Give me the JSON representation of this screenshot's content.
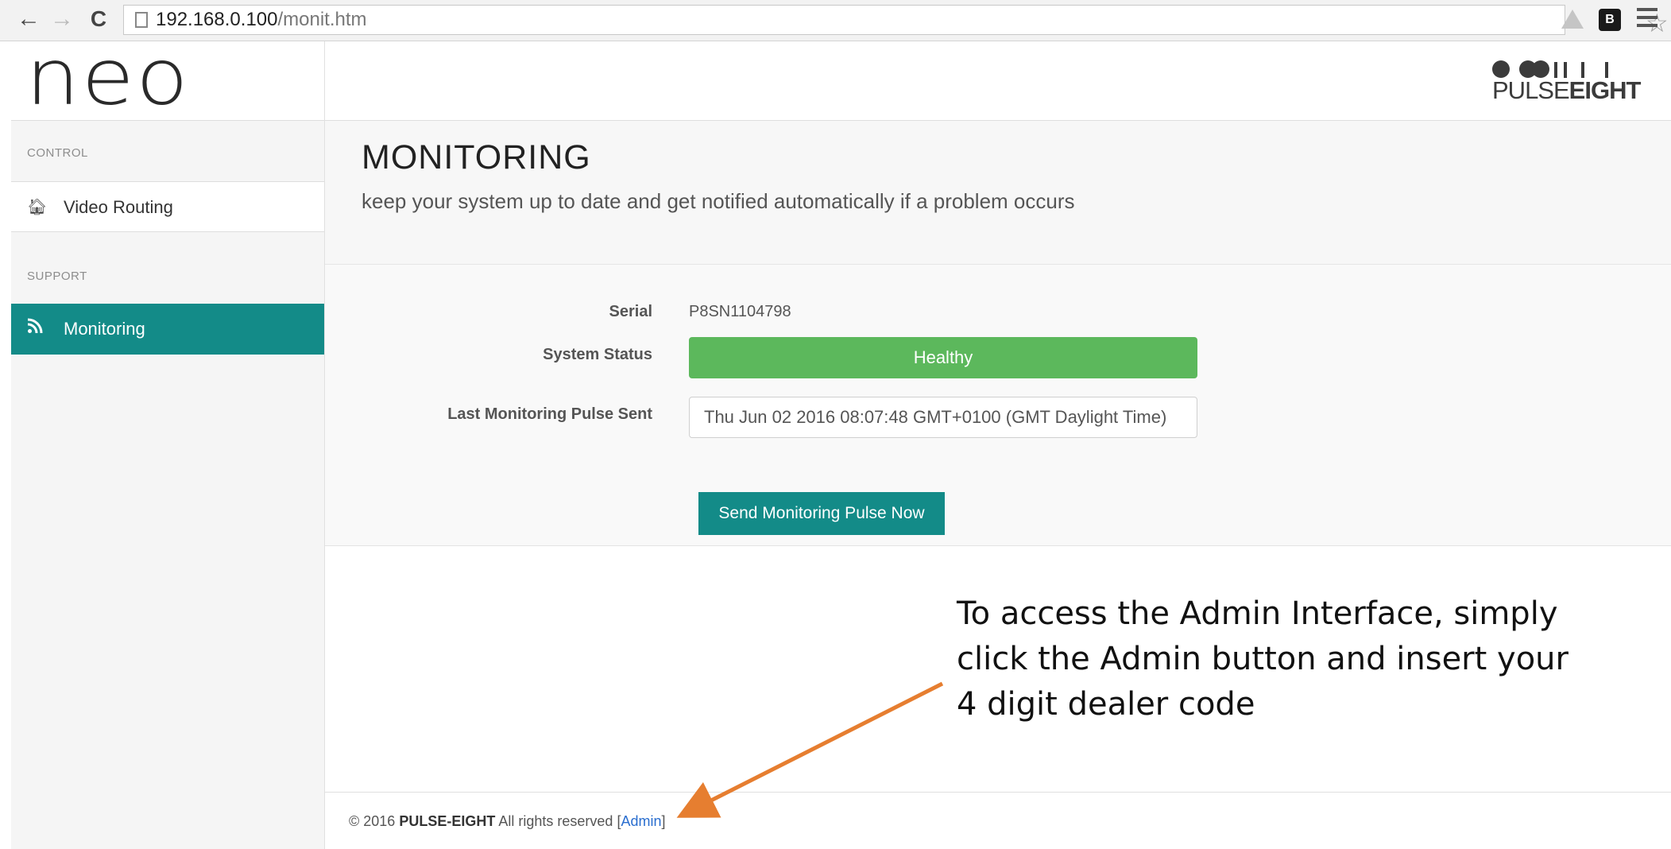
{
  "browser": {
    "url_host": "192.168.0.100",
    "url_path": "/monit.htm",
    "extension_badge": "B"
  },
  "header": {
    "brand": "neo",
    "logo_left": "PULSE",
    "logo_right": "EIGHT"
  },
  "sidebar": {
    "section_control": "CONTROL",
    "video_routing": "Video Routing",
    "section_support": "SUPPORT",
    "monitoring": "Monitoring",
    "active_item": "Monitoring",
    "accent_color": "#138b88"
  },
  "main": {
    "title": "MONITORING",
    "subtitle": "keep your system up to date and get notified automatically if a problem occurs",
    "serial_label": "Serial",
    "serial_value": "P8SN1104798",
    "status_label": "System Status",
    "status_value": "Healthy",
    "status_color": "#5cb85c",
    "pulse_label": "Last Monitoring Pulse Sent",
    "pulse_value": "Thu Jun 02 2016 08:07:48 GMT+0100 (GMT Daylight Time)",
    "send_button": "Send Monitoring Pulse Now"
  },
  "annotation": {
    "text": "To access the Admin Interface, simply click the Admin button and insert your 4 digit dealer code",
    "arrow_color": "#e67e30"
  },
  "footer": {
    "copyright": "© 2016",
    "company": "PULSE-EIGHT",
    "rights": "All rights reserved",
    "bracket_open": "[",
    "admin_link": "Admin",
    "bracket_close": "]"
  }
}
